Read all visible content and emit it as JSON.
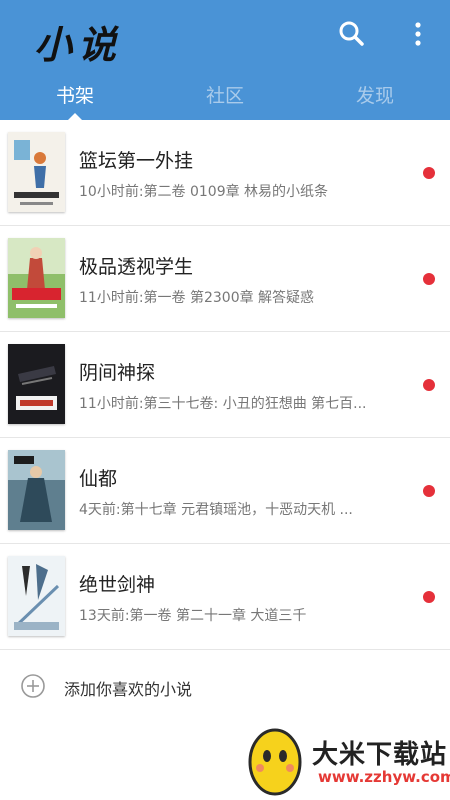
{
  "header": {
    "logo_text": "小说",
    "icons": [
      "search-icon",
      "more-vertical-icon"
    ],
    "accent_color": "#4a93d6"
  },
  "tabs": [
    {
      "label": "书架",
      "active": true
    },
    {
      "label": "社区",
      "active": false
    },
    {
      "label": "发现",
      "active": false
    }
  ],
  "books": [
    {
      "title": "篮坛第一外挂",
      "update": "10小时前:第二卷 0109章 林易的小纸条",
      "unread": true
    },
    {
      "title": "极品透视学生",
      "update": "11小时前:第一卷 第2300章 解答疑惑",
      "unread": true
    },
    {
      "title": "阴间神探",
      "update": "11小时前:第三十七卷: 小丑的狂想曲 第七百...",
      "unread": true
    },
    {
      "title": "仙都",
      "update": "4天前:第十七章 元君镇瑶池，十恶动天机 ...",
      "unread": true
    },
    {
      "title": "绝世剑神",
      "update": "13天前:第一卷 第二十一章 大道三千",
      "unread": true
    }
  ],
  "add_novel": {
    "label": "添加你喜欢的小说",
    "icon": "plus-circle-icon"
  },
  "watermark": {
    "name": "大米下载站",
    "url": "www.zzhyw.com"
  }
}
